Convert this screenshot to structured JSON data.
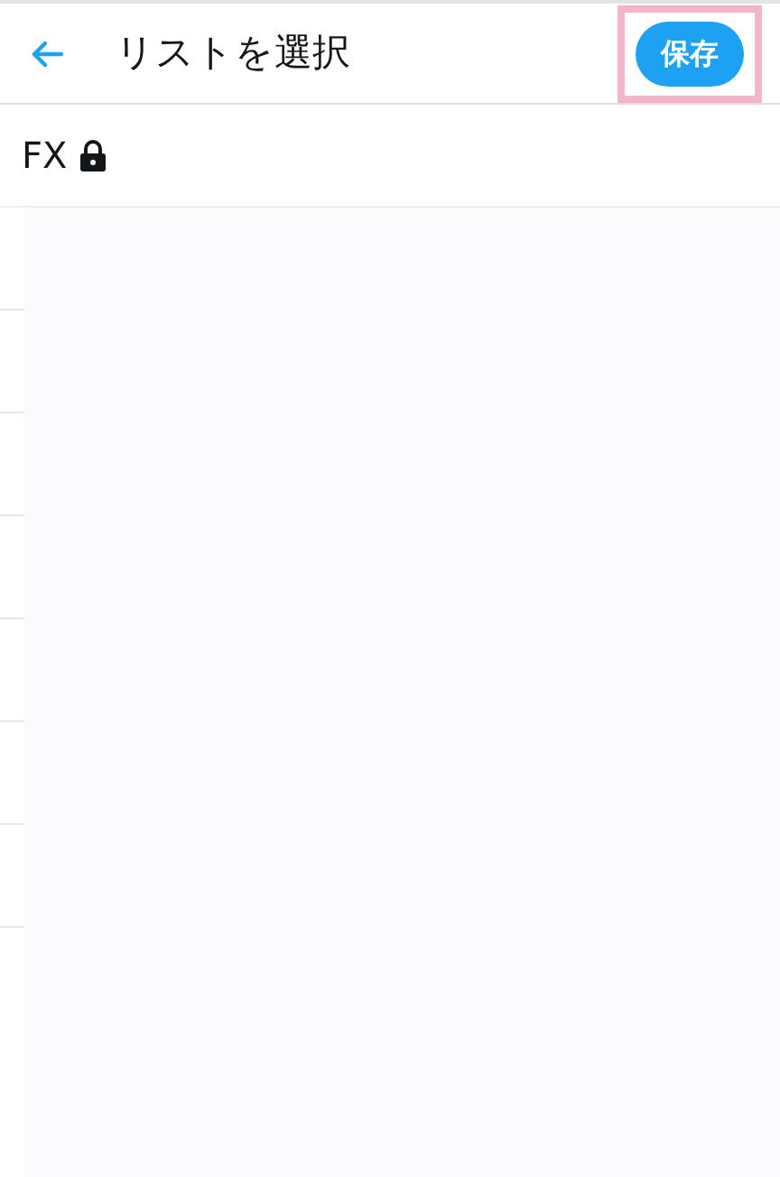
{
  "header": {
    "title": "リストを選択",
    "save_button": {
      "label": "保存",
      "highlighted": true
    }
  },
  "lists": [
    {
      "name": "FX",
      "private": true
    }
  ]
}
